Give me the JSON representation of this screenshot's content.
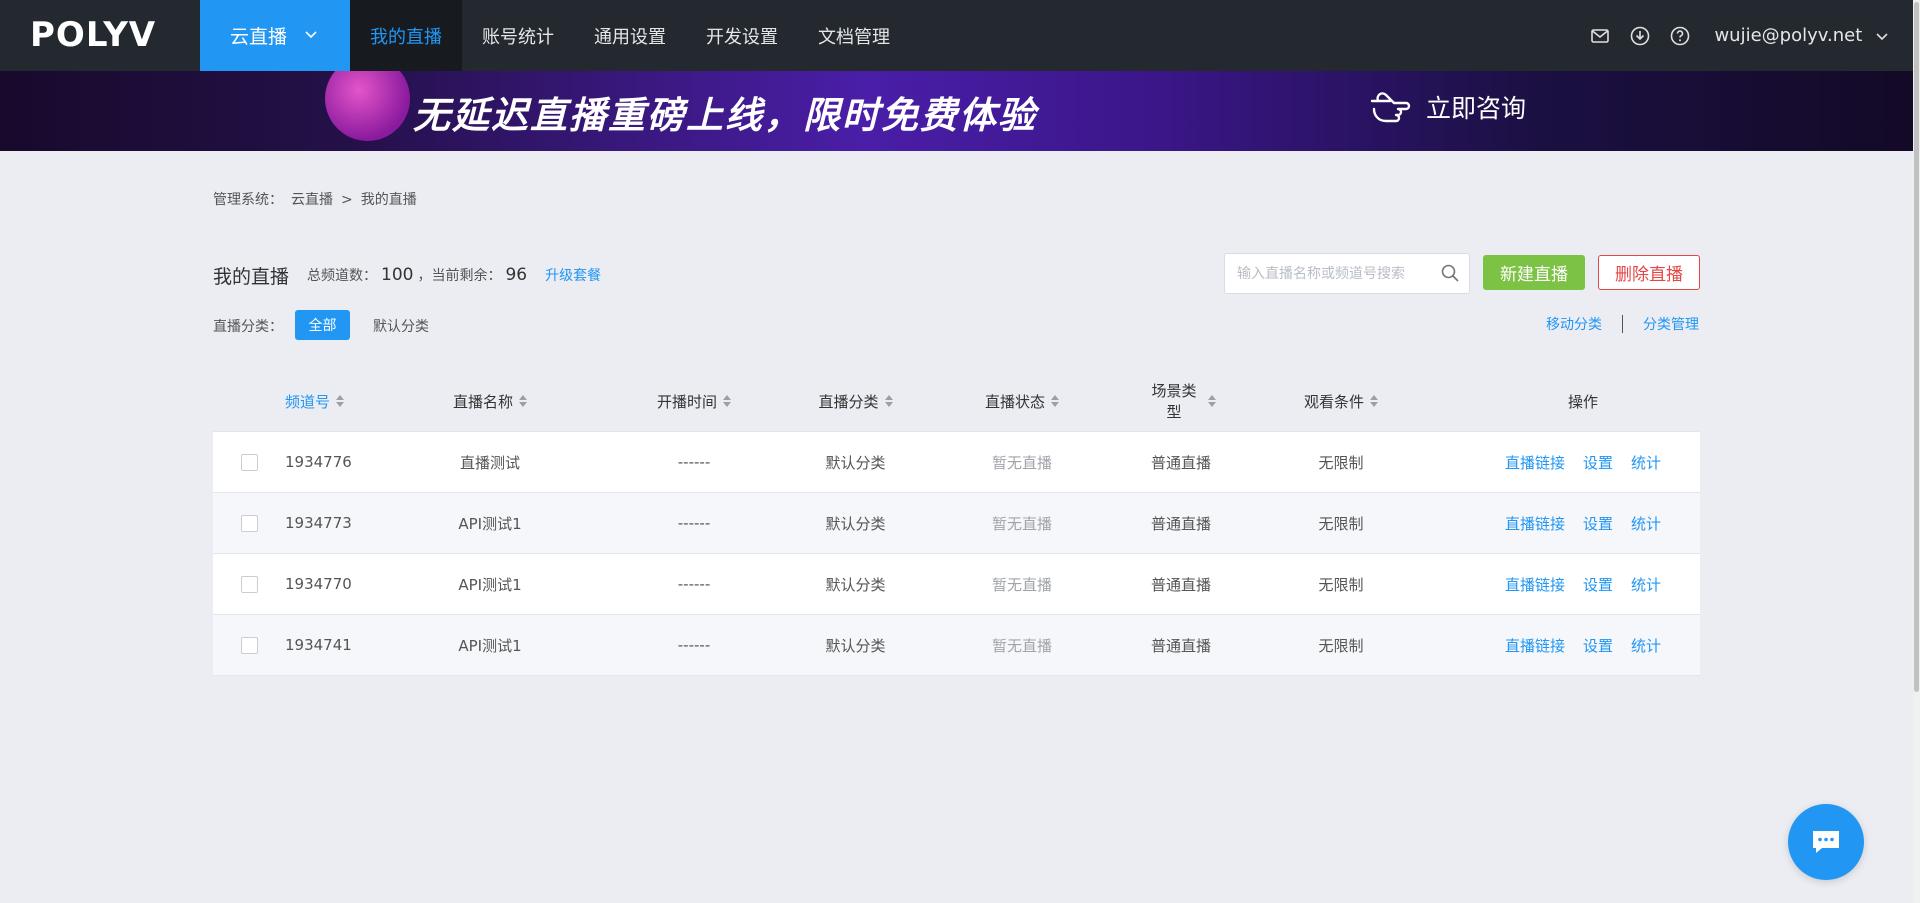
{
  "brand": {
    "logo_text": "POLYV"
  },
  "product_tab": {
    "label": "云直播"
  },
  "nav": [
    {
      "label": "我的直播"
    },
    {
      "label": "账号统计"
    },
    {
      "label": "通用设置"
    },
    {
      "label": "开发设置"
    },
    {
      "label": "文档管理"
    }
  ],
  "user": {
    "email": "wujie@polyv.net"
  },
  "banner": {
    "headline": "无延迟直播重磅上线，限时免费体验",
    "cta": "立即咨询"
  },
  "breadcrumb": {
    "prefix": "管理系统：",
    "level1": "云直播",
    "separator": ">",
    "level2": "我的直播"
  },
  "page": {
    "title": "我的直播",
    "total_label": "总频道数：",
    "total": "100",
    "remaining_label": "，当前剩余：",
    "remaining": "96",
    "upgrade": "升级套餐"
  },
  "search": {
    "placeholder": "输入直播名称或频道号搜索"
  },
  "buttons": {
    "new_live": "新建直播",
    "delete_live": "删除直播"
  },
  "category": {
    "label": "直播分类：",
    "all": "全部",
    "default": "默认分类",
    "move": "移动分类",
    "manage": "分类管理"
  },
  "table": {
    "headers": {
      "channel": "频道号",
      "name": "直播名称",
      "start_time": "开播时间",
      "category": "直播分类",
      "status": "直播状态",
      "scene": "场景类型",
      "watch": "观看条件",
      "ops": "操作"
    },
    "rows": [
      {
        "channel": "1934776",
        "name": "直播测试",
        "start_time": "------",
        "category": "默认分类",
        "status": "暂无直播",
        "scene": "普通直播",
        "watch": "无限制",
        "op_link": "直播链接",
        "op_settings": "设置",
        "op_stats": "统计"
      },
      {
        "channel": "1934773",
        "name": "API测试1",
        "start_time": "------",
        "category": "默认分类",
        "status": "暂无直播",
        "scene": "普通直播",
        "watch": "无限制",
        "op_link": "直播链接",
        "op_settings": "设置",
        "op_stats": "统计"
      },
      {
        "channel": "1934770",
        "name": "API测试1",
        "start_time": "------",
        "category": "默认分类",
        "status": "暂无直播",
        "scene": "普通直播",
        "watch": "无限制",
        "op_link": "直播链接",
        "op_settings": "设置",
        "op_stats": "统计"
      },
      {
        "channel": "1934741",
        "name": "API测试1",
        "start_time": "------",
        "category": "默认分类",
        "status": "暂无直播",
        "scene": "普通直播",
        "watch": "无限制",
        "op_link": "直播链接",
        "op_settings": "设置",
        "op_stats": "统计"
      }
    ]
  },
  "colors": {
    "accent": "#2196f3",
    "topbar": "#23292e",
    "success": "#7cc244",
    "danger": "#e54545"
  }
}
